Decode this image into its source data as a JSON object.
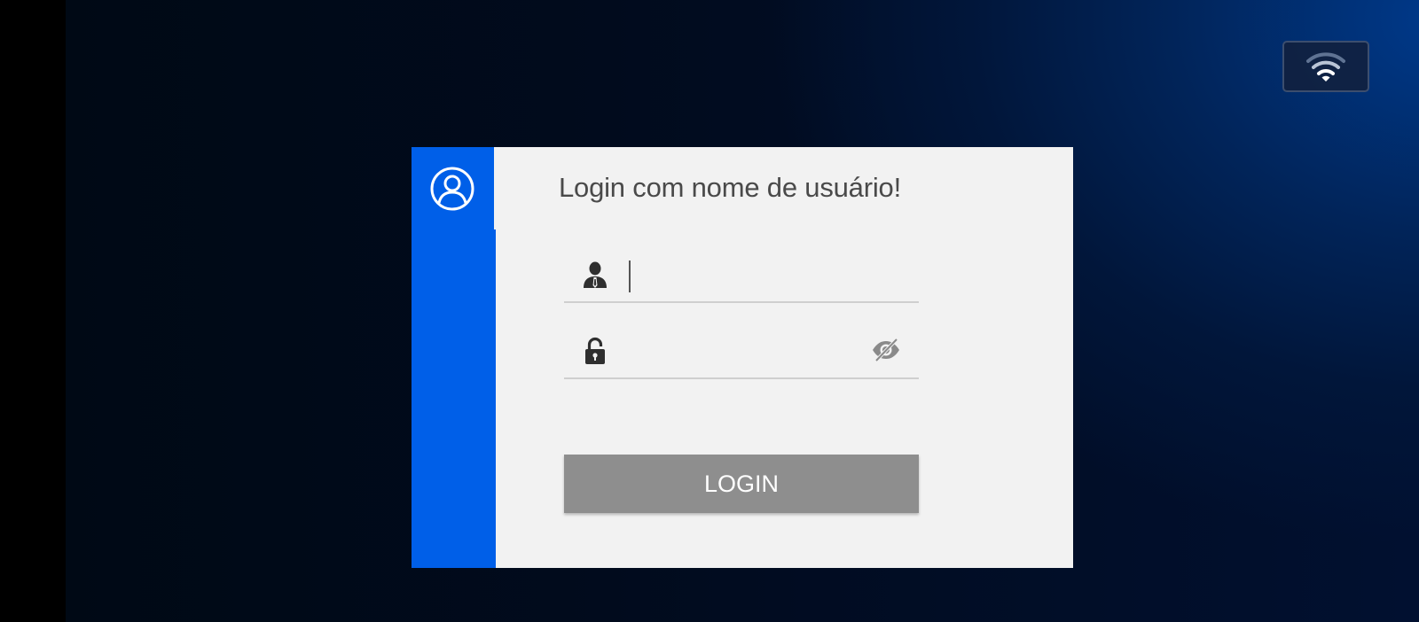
{
  "header": {
    "wifi_icon": "wifi-icon"
  },
  "login_card": {
    "title": "Login com nome de usuário!",
    "avatar_icon": "user-circle-icon",
    "username": {
      "icon": "user-icon",
      "value": "",
      "placeholder": ""
    },
    "password": {
      "icon": "lock-icon",
      "value": "",
      "placeholder": "",
      "toggle_icon": "eye-off-icon"
    },
    "login_label": "LOGIN"
  },
  "colors": {
    "accent": "#005fe8",
    "card_bg": "#f2f2f2",
    "button_bg": "#8e8e8e",
    "title_text": "#4a4a4a"
  }
}
